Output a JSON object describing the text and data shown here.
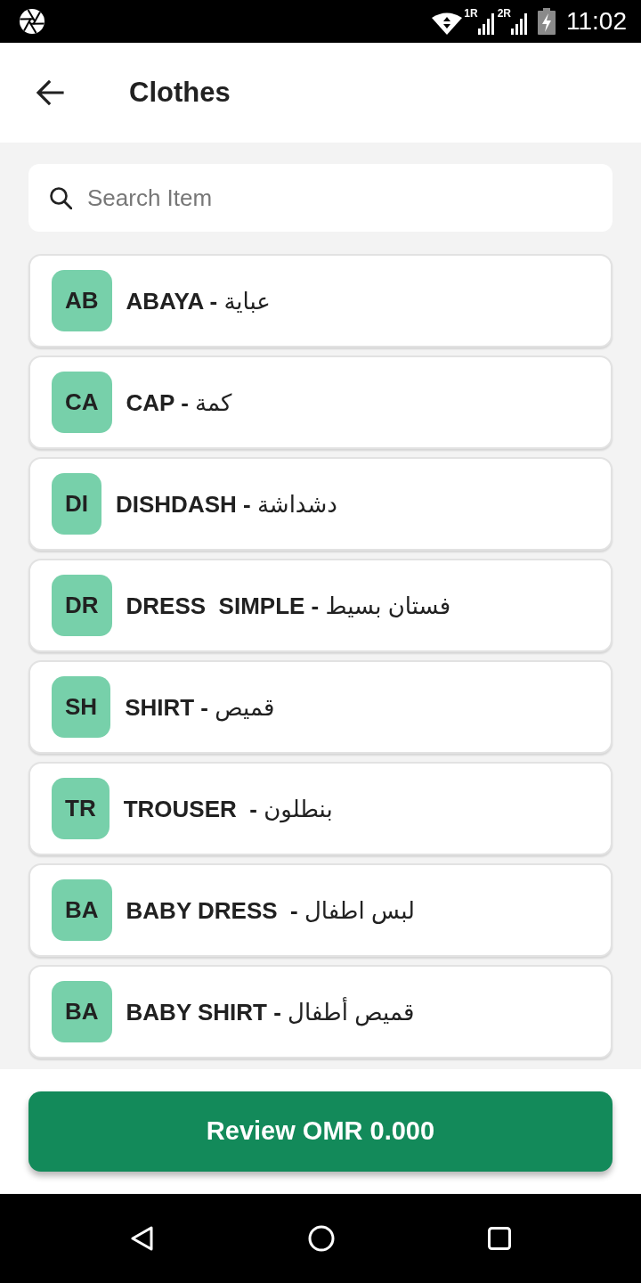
{
  "status_bar": {
    "sim_1": {
      "label": "1R"
    },
    "sim_2": {
      "label": "2R"
    },
    "time": "11:02"
  },
  "app_bar": {
    "title": "Clothes"
  },
  "search": {
    "placeholder": "Search Item"
  },
  "items": [
    {
      "initials": "AB",
      "name": "**ABAYA -** عباية"
    },
    {
      "initials": "CA",
      "name": "**CAP -** كمة"
    },
    {
      "initials": "DI",
      "name": "**DISHDASH -** دشداشة"
    },
    {
      "initials": "DR",
      "name": "**DRESS  SIMPLE -** فستان بسيط"
    },
    {
      "initials": "SH",
      "name": "**SHIRT -** قميص"
    },
    {
      "initials": "TR",
      "name": "**TROUSER  -** بنطلون"
    },
    {
      "initials": "BA",
      "name": "**BABY DRESS  -** لبس اطفال"
    },
    {
      "initials": "BA",
      "name": "**BABY SHIRT -** قميص أطفال"
    }
  ],
  "review_button": {
    "label": "Review OMR 0.000"
  }
}
